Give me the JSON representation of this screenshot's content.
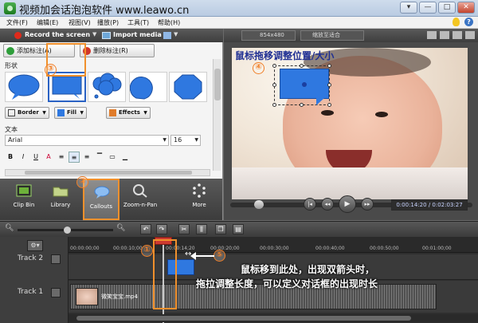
{
  "app": {
    "title": "视频加会话泡泡软件 www.leawo.cn"
  },
  "window_buttons": [
    "▾",
    "—",
    "□",
    "✕"
  ],
  "menu": [
    "文件(F)",
    "编辑(E)",
    "视图(V)",
    "播放(P)",
    "工具(T)",
    "帮助(H)"
  ],
  "toolbar": {
    "record": "Record the screen",
    "import": "Import media"
  },
  "callout_panel": {
    "add_label": "添加标注(A)",
    "delete_label": "删除标注(R)",
    "shape_label": "形状",
    "border_label": "Border",
    "fill_label": "Fill",
    "effects_label": "Effects",
    "text_label": "文本",
    "font": "Arial",
    "size": "16"
  },
  "tools": [
    {
      "label": "Clip Bin"
    },
    {
      "label": "Library"
    },
    {
      "label": "Callouts"
    },
    {
      "label": "Zoom-n-Pan"
    },
    {
      "label": "More"
    }
  ],
  "preview": {
    "resolution": "854x480",
    "fit": "缩放至适合",
    "timecode": "0:00:14:20 / 0:02:03:27",
    "progress": 0.12
  },
  "annotations": {
    "n1": "①",
    "n2": "②",
    "n3": "③",
    "n4": "④",
    "n5": "⑤",
    "drag_tip": "鼠标拖移调整位置/大小",
    "line1": "鼠标移到此处，出现双箭头时，",
    "line2": "拖拉调整长度，可以定义对话框的出现时长"
  },
  "timeline": {
    "ticks": [
      "00:00:00;00",
      "00:00:10;00",
      "00:00:14;20",
      "00:00:20;00",
      "00:00:30;00",
      "00:00:40;00",
      "00:00:50;00",
      "00:01:00;00"
    ],
    "tracks": [
      {
        "label": "Track 2"
      },
      {
        "label": "Track 1",
        "clip": "微笑宝宝.mp4"
      }
    ]
  },
  "colors": {
    "accent_orange": "#f0902c",
    "callout_blue": "#2f78e0",
    "annotation_blue": "#1f2f93"
  }
}
